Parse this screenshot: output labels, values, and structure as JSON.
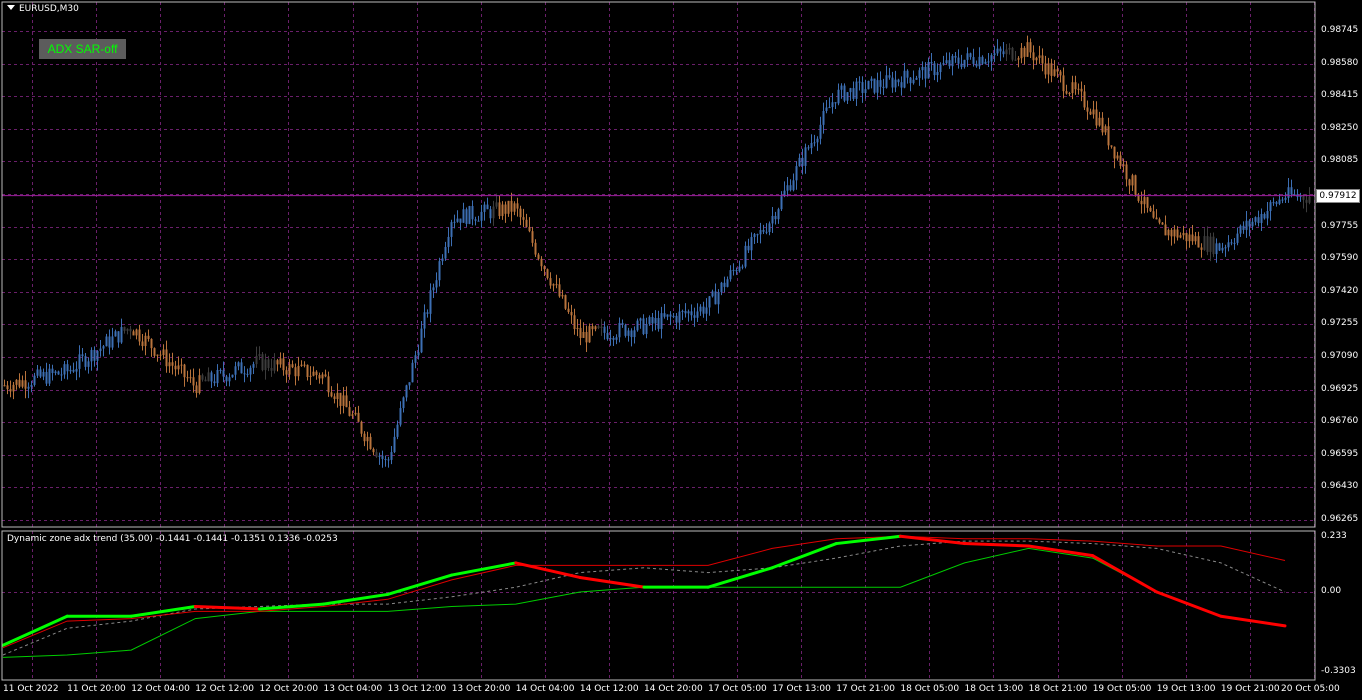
{
  "chart_window": {
    "symbol_title": "EURUSD,M30",
    "adx_button_label": "ADX SAR-off",
    "current_price": "0.97912",
    "price_axis_labels": [
      "0.98745",
      "0.98580",
      "0.98415",
      "0.98250",
      "0.98085",
      "0.97755",
      "0.97590",
      "0.97420",
      "0.97255",
      "0.97090",
      "0.96925",
      "0.96760",
      "0.96595",
      "0.96430",
      "0.96265"
    ],
    "indicator_label": "Dynamic zone adx trend (35.00) -0.1441 -0.1441 -0.1351 0.1336 -0.0253",
    "indicator_axis_labels": [
      "0.233",
      "0.00",
      "-0.3303"
    ],
    "time_axis_labels": [
      "11 Oct 2022",
      "11 Oct 20:00",
      "12 Oct 04:00",
      "12 Oct 12:00",
      "12 Oct 20:00",
      "13 Oct 04:00",
      "13 Oct 12:00",
      "13 Oct 20:00",
      "14 Oct 04:00",
      "14 Oct 12:00",
      "14 Oct 20:00",
      "17 Oct 05:00",
      "17 Oct 13:00",
      "17 Oct 21:00",
      "18 Oct 05:00",
      "18 Oct 13:00",
      "18 Oct 21:00",
      "19 Oct 05:00",
      "19 Oct 13:00",
      "19 Oct 21:00",
      "20 Oct 05:00"
    ],
    "colors": {
      "background": "#000000",
      "grid": "#6a1f6a",
      "bull_candle": "#3d6fb4",
      "bear_candle": "#b8733c",
      "neutral_candle": "#3c3c3c",
      "adx_up": "#00ff00",
      "adx_down": "#ff0000",
      "button_text": "#00ff00"
    }
  },
  "chart_data": [
    {
      "type": "candlestick",
      "title": "EURUSD,M30",
      "ylim": [
        0.96265,
        0.98745
      ],
      "close_path": [
        [
          "11 Oct 2022",
          0.9695
        ],
        [
          "11 Oct 20:00",
          0.9702
        ],
        [
          "12 Oct 04:00",
          0.9725
        ],
        [
          "12 Oct 12:00",
          0.9695
        ],
        [
          "12 Oct 20:00",
          0.9707
        ],
        [
          "13 Oct 04:00",
          0.97
        ],
        [
          "13 Oct 12:00",
          0.9655
        ],
        [
          "13 Oct 20:00",
          0.978
        ],
        [
          "14 Oct 04:00",
          0.9785
        ],
        [
          "14 Oct 12:00",
          0.972
        ],
        [
          "14 Oct 20:00",
          0.9725
        ],
        [
          "17 Oct 05:00",
          0.9735
        ],
        [
          "17 Oct 13:00",
          0.978
        ],
        [
          "17 Oct 21:00",
          0.9842
        ],
        [
          "18 Oct 05:00",
          0.985
        ],
        [
          "18 Oct 13:00",
          0.986
        ],
        [
          "18 Oct 21:00",
          0.9865
        ],
        [
          "19 Oct 05:00",
          0.9835
        ],
        [
          "19 Oct 13:00",
          0.9775
        ],
        [
          "19 Oct 21:00",
          0.9765
        ],
        [
          "20 Oct 05:00",
          0.9791
        ]
      ],
      "current": 0.97912
    },
    {
      "type": "line",
      "title": "Dynamic zone adx trend (35.00)",
      "ylim": [
        -0.3303,
        0.233
      ],
      "x": [
        "11 Oct 2022",
        "11 Oct 20:00",
        "12 Oct 04:00",
        "12 Oct 12:00",
        "12 Oct 20:00",
        "13 Oct 04:00",
        "13 Oct 12:00",
        "13 Oct 20:00",
        "14 Oct 04:00",
        "14 Oct 12:00",
        "14 Oct 20:00",
        "17 Oct 05:00",
        "17 Oct 13:00",
        "17 Oct 21:00",
        "18 Oct 05:00",
        "18 Oct 13:00",
        "18 Oct 21:00",
        "19 Oct 05:00",
        "19 Oct 13:00",
        "19 Oct 21:00",
        "20 Oct 05:00"
      ],
      "series": [
        {
          "values": [
            -0.22,
            -0.1,
            -0.1,
            -0.06,
            -0.07,
            -0.05,
            -0.01,
            0.07,
            0.12,
            0.06,
            0.02,
            0.02,
            0.1,
            0.2,
            0.23,
            0.2,
            0.19,
            0.15,
            0.0,
            -0.1,
            -0.14
          ]
        },
        {
          "values": [
            -0.23,
            -0.12,
            -0.11,
            -0.08,
            -0.08,
            -0.06,
            -0.03,
            0.05,
            0.11,
            0.11,
            0.11,
            0.11,
            0.18,
            0.22,
            0.23,
            0.22,
            0.22,
            0.21,
            0.19,
            0.19,
            0.13
          ]
        },
        {
          "values": [
            -0.27,
            -0.26,
            -0.24,
            -0.11,
            -0.08,
            -0.08,
            -0.08,
            -0.06,
            -0.05,
            0.0,
            0.02,
            0.02,
            0.02,
            0.02,
            0.02,
            0.12,
            0.18,
            0.14,
            0.0,
            -0.1,
            -0.14
          ]
        },
        {
          "values": [
            -0.26,
            -0.15,
            -0.12,
            -0.07,
            -0.06,
            -0.05,
            -0.05,
            -0.02,
            0.02,
            0.08,
            0.1,
            0.08,
            0.1,
            0.14,
            0.19,
            0.21,
            0.21,
            0.2,
            0.18,
            0.12,
            0.0
          ]
        }
      ]
    }
  ]
}
